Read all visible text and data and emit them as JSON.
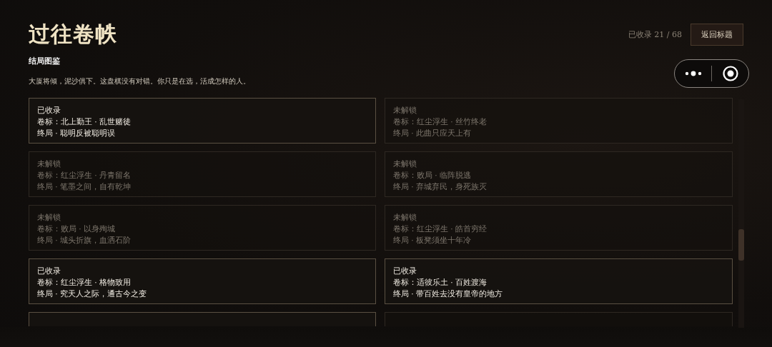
{
  "header": {
    "title": "过往卷帙",
    "subtitle": "结局图鉴",
    "description": "大厦将倾，泥沙俱下。这盘棋没有对错。你只是在选，活成怎样的人。",
    "progress": "已收录 21 / 68",
    "back_button": "返回标题"
  },
  "endings": [
    {
      "unlocked": true,
      "status": "已收录",
      "volume": "卷标：北上勤王 · 乱世赌徒",
      "ending": "终局 · 聪明反被聪明误"
    },
    {
      "unlocked": false,
      "status": "未解锁",
      "volume": "卷标：红尘浮生 · 丝竹终老",
      "ending": "终局 · 此曲只应天上有"
    },
    {
      "unlocked": false,
      "status": "未解锁",
      "volume": "卷标：红尘浮生 · 丹青留名",
      "ending": "终局 · 笔墨之间，自有乾坤"
    },
    {
      "unlocked": false,
      "status": "未解锁",
      "volume": "卷标：败局 · 临阵脱逃",
      "ending": "终局 · 弃城弃民，身死族灭"
    },
    {
      "unlocked": false,
      "status": "未解锁",
      "volume": "卷标：败局 · 以身殉城",
      "ending": "终局 · 城头折旗，血洒石阶"
    },
    {
      "unlocked": false,
      "status": "未解锁",
      "volume": "卷标：红尘浮生 · 皓首穷经",
      "ending": "终局 · 板凳须坐十年冷"
    },
    {
      "unlocked": true,
      "status": "已收录",
      "volume": "卷标：红尘浮生 · 格物致用",
      "ending": "终局 · 究天人之际，通古今之变"
    },
    {
      "unlocked": true,
      "status": "已收录",
      "volume": "卷标：适彼乐土 · 百姓渡海",
      "ending": "终局 · 带百姓去没有皇帝的地方"
    },
    {
      "unlocked": true
    },
    {
      "unlocked": false
    }
  ]
}
